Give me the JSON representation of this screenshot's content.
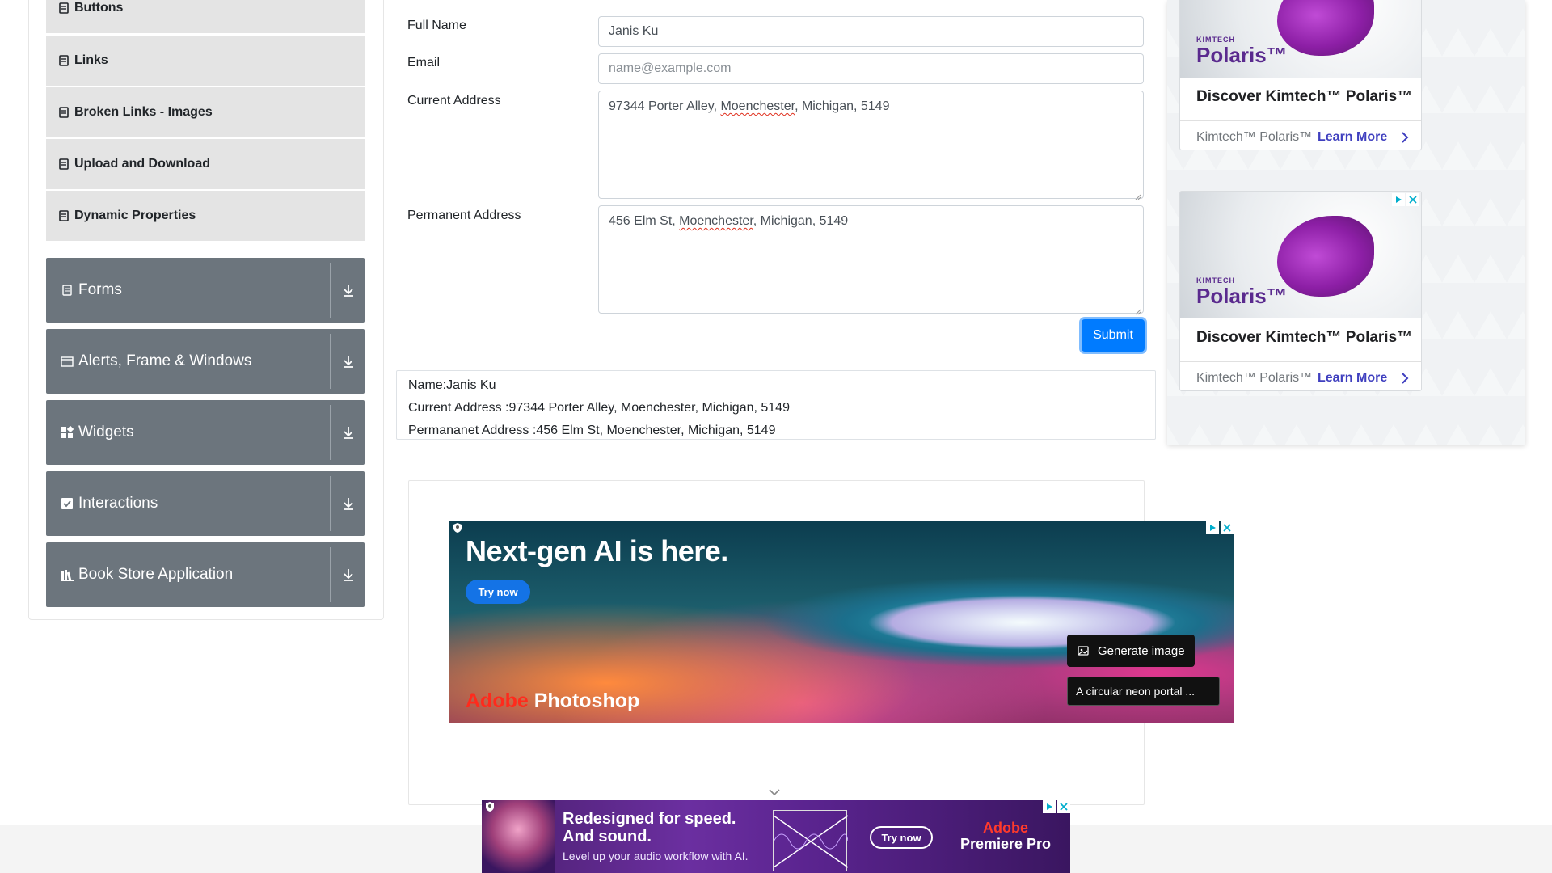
{
  "sidebar": {
    "elements_items": [
      {
        "label": "Buttons"
      },
      {
        "label": "Links"
      },
      {
        "label": "Broken Links - Images"
      },
      {
        "label": "Upload and Download"
      },
      {
        "label": "Dynamic Properties"
      }
    ],
    "groups": [
      {
        "label": "Forms",
        "icon": "form-icon"
      },
      {
        "label": "Alerts, Frame & Windows",
        "icon": "window-icon"
      },
      {
        "label": "Widgets",
        "icon": "widgets-icon"
      },
      {
        "label": "Interactions",
        "icon": "interactions-icon"
      },
      {
        "label": "Book Store Application",
        "icon": "book-store-icon"
      }
    ]
  },
  "form": {
    "full_name": {
      "label": "Full Name",
      "value": "Janis Ku"
    },
    "email": {
      "label": "Email",
      "value": "",
      "placeholder": "name@example.com"
    },
    "current_address": {
      "label": "Current Address",
      "pre": "97344 Porter Alley, ",
      "misspelled": "Moenchester",
      "post": ", Michigan, 5149"
    },
    "permanent_address": {
      "label": "Permanent Address",
      "pre": "456 Elm St, ",
      "misspelled": "Moenchester",
      "post": ", Michigan, 5149"
    },
    "submit_label": "Submit"
  },
  "output": {
    "name": "Name:Janis Ku",
    "current_address": "Current Address :97344 Porter Alley, Moenchester, Michigan, 5149",
    "permanent_address": "Permananet Address :456 Elm St, Moenchester, Michigan, 5149"
  },
  "right_ads": [
    {
      "brand_small": "KIMTECH",
      "brand": "Polaris™",
      "title": "Discover Kimtech™ Polaris™",
      "sponsor": "Kimtech™ Polaris™",
      "cta": "Learn More"
    },
    {
      "brand_small": "KIMTECH",
      "brand": "Polaris™",
      "title": "Discover Kimtech™ Polaris™",
      "sponsor": "Kimtech™ Polaris™",
      "cta": "Learn More"
    }
  ],
  "center_ad": {
    "headline": "Next-gen AI is here.",
    "cta": "Try now",
    "brand_red": "Adobe",
    "brand_white": " Photoshop",
    "generate_label": "Generate image",
    "prompt_text": "A circular neon portal ..."
  },
  "bottom_ad": {
    "line1": "Redesigned for speed.",
    "line2": "And sound.",
    "sub": "Level up your audio workflow with AI.",
    "cta": "Try now",
    "brand_red": "Adobe",
    "brand_white": "Premiere Pro"
  },
  "colors": {
    "primary": "#007bff",
    "sidebar_group_bg": "#6c757d",
    "sidebar_item_bg": "#e4e4e4"
  }
}
